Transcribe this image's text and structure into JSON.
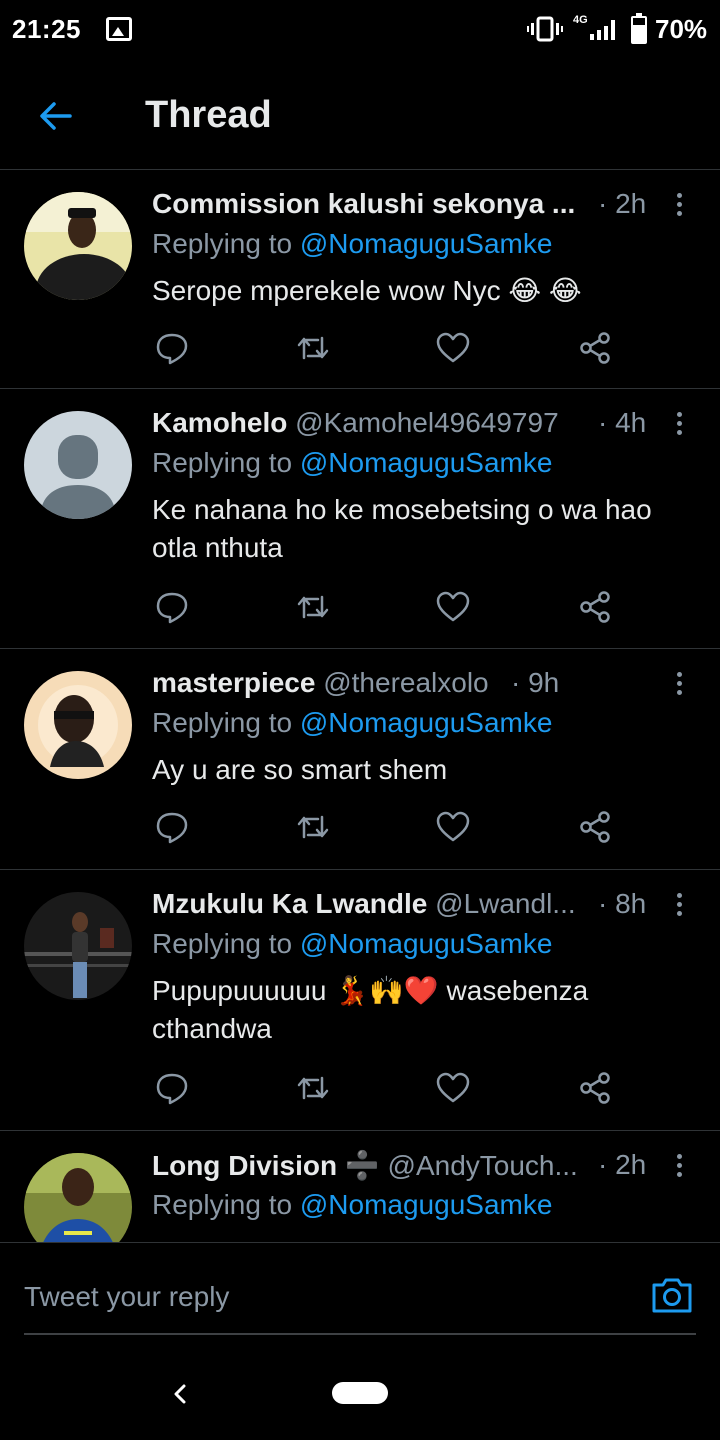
{
  "status_bar": {
    "time": "21:25",
    "network": "4G",
    "battery": "70%"
  },
  "header": {
    "title": "Thread"
  },
  "tweets": [
    {
      "name": "Commission kalushi sekonya ...",
      "handle": "",
      "time": "· 2h",
      "replying_label": "Replying to ",
      "replying_to": "@NomaguguSamke",
      "text": "Serope mperekele wow Nyc 😂 😂"
    },
    {
      "name": "Kamohelo",
      "handle": " @Kamohel49649797",
      "time": "· 4h",
      "replying_label": "Replying to ",
      "replying_to": "@NomaguguSamke",
      "text": "Ke nahana ho ke mosebetsing o wa hao otla nthuta"
    },
    {
      "name": "masterpiece",
      "handle": " @therealxolo",
      "time": "· 9h",
      "replying_label": "Replying to ",
      "replying_to": "@NomaguguSamke",
      "text": "Ay u are so smart  shem"
    },
    {
      "name": "Mzukulu Ka Lwandle",
      "handle": " @Lwandl...",
      "time": "· 8h",
      "replying_label": "Replying to ",
      "replying_to": "@NomaguguSamke",
      "text": "Pupupuuuuuu 💃🙌❤️ wasebenza cthandwa"
    },
    {
      "name": "Long Division ➗",
      "handle": " @AndyTouch...",
      "time": "· 2h",
      "replying_label": "Replying to ",
      "replying_to": "@NomaguguSamke",
      "text": ""
    }
  ],
  "reply_bar": {
    "placeholder": "Tweet your reply"
  },
  "colors": {
    "accent": "#1d9bf0",
    "background": "#000000",
    "muted": "#8b98a5"
  },
  "icons": [
    "back-arrow-icon",
    "more-icon",
    "reply-icon",
    "retweet-icon",
    "like-icon",
    "share-icon",
    "camera-icon"
  ]
}
